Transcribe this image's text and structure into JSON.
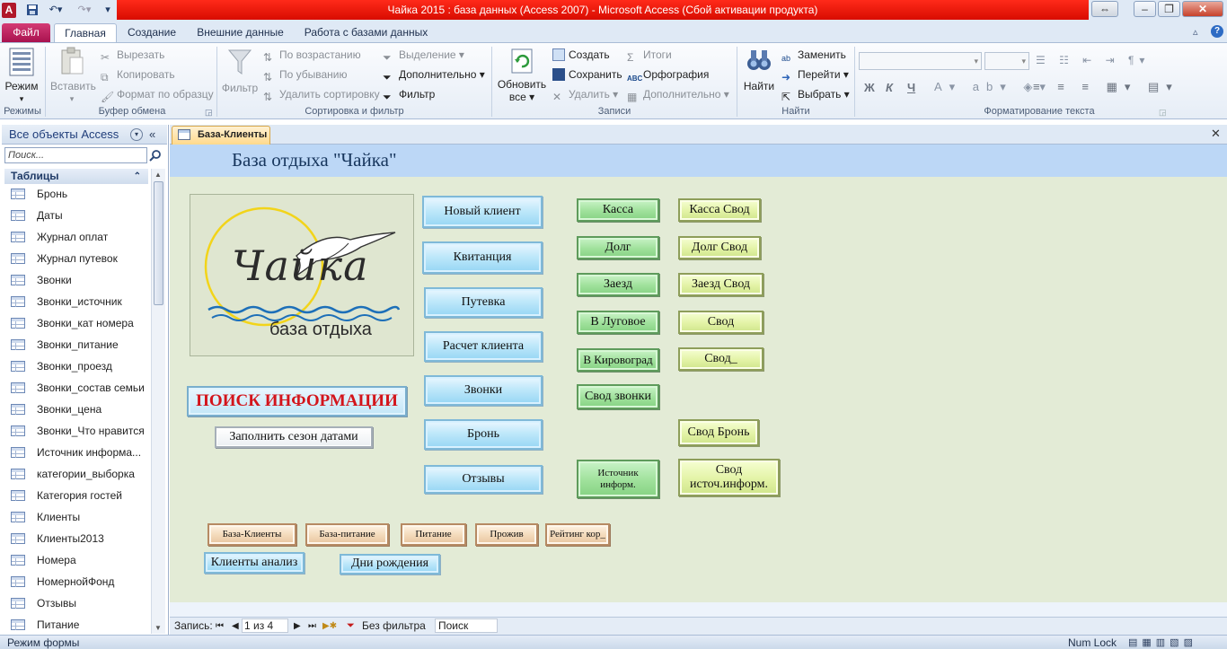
{
  "app": {
    "title": "Чайка 2015 : база данных (Access 2007)  -  Microsoft Access (Сбой активации продукта)",
    "window_controls": [
      "restore-max",
      "minimize",
      "restore",
      "close"
    ]
  },
  "ribbon_tabs": [
    {
      "label": "Файл"
    },
    {
      "label": "Главная"
    },
    {
      "label": "Создание"
    },
    {
      "label": "Внешние данные"
    },
    {
      "label": "Работа с базами данных"
    }
  ],
  "ribbon": {
    "views": {
      "mode": "Режим",
      "group": "Режимы"
    },
    "clipboard": {
      "paste": "Вставить",
      "cut": "Вырезать",
      "copy": "Копировать",
      "format_painter": "Формат по образцу",
      "group": "Буфер обмена"
    },
    "sort": {
      "filter": "Фильтр",
      "ascending": "По возрастанию",
      "descending": "По убыванию",
      "remove_sort": "Удалить сортировку",
      "selection": "Выделение",
      "advanced": "Дополнительно",
      "toggle_filter": "Фильтр",
      "group": "Сортировка и фильтр"
    },
    "records": {
      "refresh": "Обновить",
      "refresh_all": "все",
      "new": "Создать",
      "save": "Сохранить",
      "delete": "Удалить",
      "totals": "Итоги",
      "spelling": "Орфография",
      "more": "Дополнительно",
      "group": "Записи"
    },
    "find": {
      "find": "Найти",
      "replace": "Заменить",
      "goto": "Перейти",
      "select": "Выбрать",
      "group": "Найти"
    },
    "text_format": {
      "group": "Форматирование текста",
      "bold": "Ж",
      "italic": "К",
      "underline": "Ч"
    }
  },
  "nav": {
    "header": "Все объекты Access",
    "search_placeholder": "Поиск...",
    "section": "Таблицы",
    "items": [
      "Бронь",
      "Даты",
      "Журнал оплат",
      "Журнал путевок",
      "Звонки",
      "Звонки_источник",
      "Звонки_кат номера",
      "Звонки_питание",
      "Звонки_проезд",
      "Звонки_состав семьи",
      "Звонки_цена",
      "Звонки_Что нравится",
      "Источник информа...",
      "категории_выборка",
      "Категория гостей",
      "Клиенты",
      "Клиенты2013",
      "Номера",
      "НомернойФонд",
      "Отзывы",
      "Питание"
    ]
  },
  "document": {
    "tab": "База-Клиенты",
    "form_title": "База отдыха \"Чайка\"",
    "logo": {
      "name": "Чайка",
      "subtitle": "база отдыха"
    },
    "search_button": "ПОИСК ИНФОРМАЦИИ",
    "fill_button": "Заполнить сезон датами",
    "blue_buttons": [
      "Новый клиент",
      "Квитанция",
      "Путевка",
      "Расчет клиента",
      "Звонки",
      "Бронь",
      "Отзывы"
    ],
    "green_buttons": [
      "Касса",
      "Долг",
      "Заезд",
      "В Луговое",
      "В Кировоград",
      "Свод звонки",
      "Источник информ."
    ],
    "lime_buttons": [
      "Касса Свод",
      "Долг Свод",
      "Заезд Свод",
      "Свод",
      "Свод_",
      "Свод Бронь",
      "Свод источ.информ."
    ],
    "tan_buttons": [
      "База-Клиенты",
      "База-питание",
      "Питание",
      "Прожив",
      "Рейтинг кор_"
    ],
    "bottom_blue_buttons": [
      "Клиенты анализ",
      "Дни рождения"
    ]
  },
  "record_nav": {
    "label": "Запись:",
    "position": "1 из 4",
    "filter": "Без фильтра",
    "search": "Поиск"
  },
  "status": {
    "left": "Режим формы",
    "num_lock": "Num Lock"
  },
  "colors": {
    "title_bar": "#e01808",
    "file_tab": "#c2185b",
    "form_header": "#bcd7f6",
    "form_body": "#e3ebd6"
  }
}
